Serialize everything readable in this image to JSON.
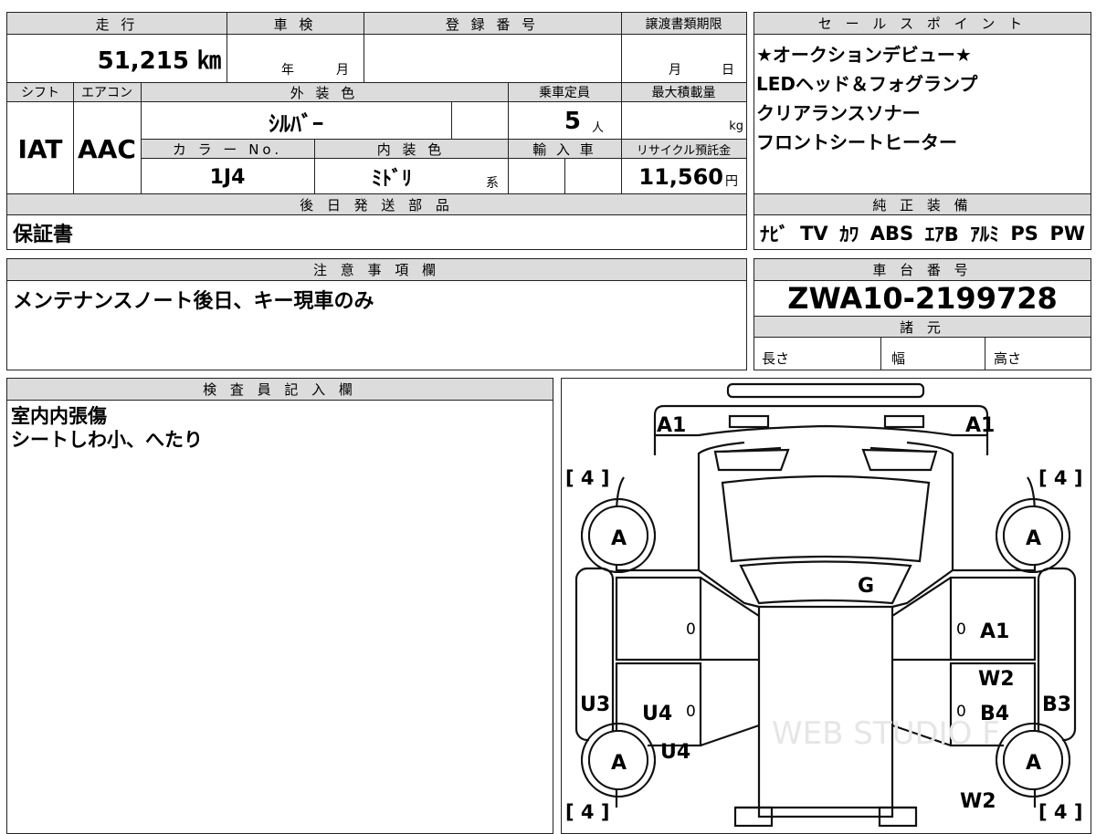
{
  "top_table": {
    "mileage_label": "走 行",
    "mileage_value": "51,215 ㎞",
    "shaken_label": "車 検",
    "shaken_year": "年",
    "shaken_month": "月",
    "reg_label": "登 録 番 号",
    "transfer_label": "譲渡書類期限",
    "transfer_month": "月",
    "transfer_day": "日",
    "shift_label": "シフト",
    "aircon_label": "エアコン",
    "ext_color_label": "外 装 色",
    "capacity_label": "乗車定員",
    "max_load_label": "最大積載量",
    "shift_value": "IAT",
    "aircon_value": "AAC",
    "ext_color_value": "ｼﾙﾊﾞｰ",
    "capacity_value": "5",
    "capacity_unit": "人",
    "load_unit": "kg",
    "color_no_label": "カ ラ ー No.",
    "int_color_label": "内 装 色",
    "import_label": "輸 入 車",
    "recycle_label": "リサイクル預託金",
    "color_no_value": "1J4",
    "int_color_value": "ﾐﾄﾞﾘ",
    "int_color_suffix": "系",
    "recycle_value": "11,560",
    "recycle_unit": "円",
    "later_parts_label": "後 日 発 送 部 品",
    "later_parts_value": "保証書"
  },
  "sales_points": {
    "label": "セ ー ル ス ポ イ ン ト",
    "lines": [
      "★オークションデビュー★",
      "LEDヘッド＆フォグランプ",
      "クリアランスソナー",
      "フロントシートヒーター"
    ],
    "equipment_label": "純 正 装 備",
    "equipment_items": [
      "ﾅﾋﾞ",
      "TV",
      "ｶﾜ",
      "ABS",
      "ｴｱB",
      "ｱﾙﾐ",
      "PS",
      "PW"
    ]
  },
  "notes": {
    "label": "注 意 事 項 欄",
    "text": "メンテナンスノート後日、キー現車のみ"
  },
  "chassis": {
    "label": "車 台 番 号",
    "value": "ZWA10-2199728",
    "spec_label": "諸 元",
    "length_label": "長さ",
    "width_label": "幅",
    "height_label": "高さ"
  },
  "inspector": {
    "label": "検 査 員 記 入 欄",
    "lines": [
      "室内内張傷",
      "シートしわ小、へたり"
    ]
  },
  "diagram": {
    "marks": {
      "a1_left": "A1",
      "a1_right": "A1",
      "bracket_tl": "[ 4 ]",
      "bracket_tr": "[ 4 ]",
      "bracket_bl": "[ 4 ]",
      "bracket_br": "[ 4 ]",
      "tire_fl": "A",
      "tire_fr": "A",
      "tire_rl": "A",
      "tire_rr": "A",
      "g": "G",
      "zero_1": "0",
      "zero_2": "0",
      "zero_3": "0",
      "zero_4": "0",
      "a1_door": "A1",
      "w2_a": "W2",
      "b4": "B4",
      "b3": "B3",
      "u3": "U3",
      "u4_a": "U4",
      "u4_b": "U4",
      "w2_b": "W2"
    },
    "watermark": "WEB STUDIO F"
  }
}
